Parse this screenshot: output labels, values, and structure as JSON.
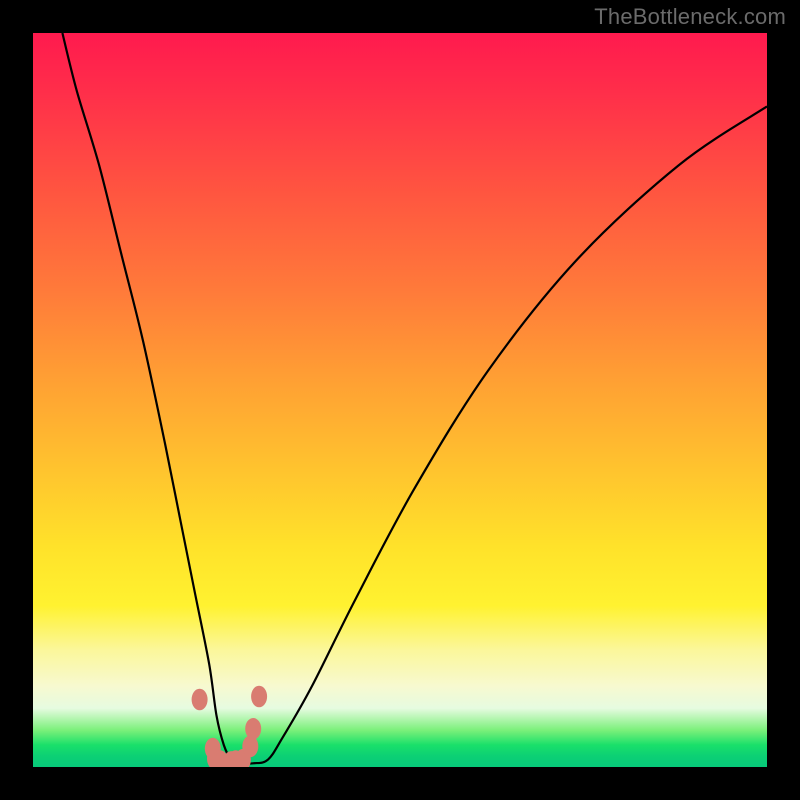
{
  "watermark": {
    "text": "TheBottleneck.com"
  },
  "colors": {
    "frame": "#000000",
    "curve": "#000000",
    "marker": "#d97c71",
    "gradient_stops": [
      "#ff1a4e",
      "#ff2e4a",
      "#ff5640",
      "#ff7a3a",
      "#ffa233",
      "#ffc52e",
      "#ffe22a",
      "#fff230",
      "#fbf79a",
      "#f7f9d0",
      "#e6fbe0",
      "#7af07a",
      "#1ae06a",
      "#0cd074",
      "#07c97a"
    ]
  },
  "chart_data": {
    "type": "line",
    "title": "",
    "xlabel": "",
    "ylabel": "",
    "x_range": [
      0,
      100
    ],
    "y_range": [
      0,
      100
    ],
    "note": "V-shaped bottleneck curve. Values are approximate percentages read from the image: x = horizontal position across plot (0=left, 100=right), y = vertical height of curve (0=bottom/green, 100=top/red).",
    "series": [
      {
        "name": "bottleneck-curve",
        "x": [
          4,
          6,
          9,
          12,
          15,
          18,
          20,
          22,
          24,
          25,
          26,
          27,
          28,
          30,
          32,
          34,
          38,
          44,
          52,
          62,
          74,
          88,
          100
        ],
        "y": [
          100,
          92,
          82,
          70,
          58,
          44,
          34,
          24,
          14,
          7,
          3,
          1,
          0.5,
          0.5,
          1,
          4,
          11,
          23,
          38,
          54,
          69,
          82,
          90
        ]
      }
    ],
    "markers": {
      "name": "highlighted-points",
      "note": "salmon dots near the minimum",
      "x": [
        22.7,
        24.5,
        24.8,
        25.5,
        27.0,
        27.6,
        28.6,
        29.6,
        30.0,
        30.8
      ],
      "y": [
        9.2,
        2.5,
        1.1,
        0.8,
        0.7,
        0.8,
        1.0,
        2.8,
        5.2,
        9.6
      ]
    }
  }
}
